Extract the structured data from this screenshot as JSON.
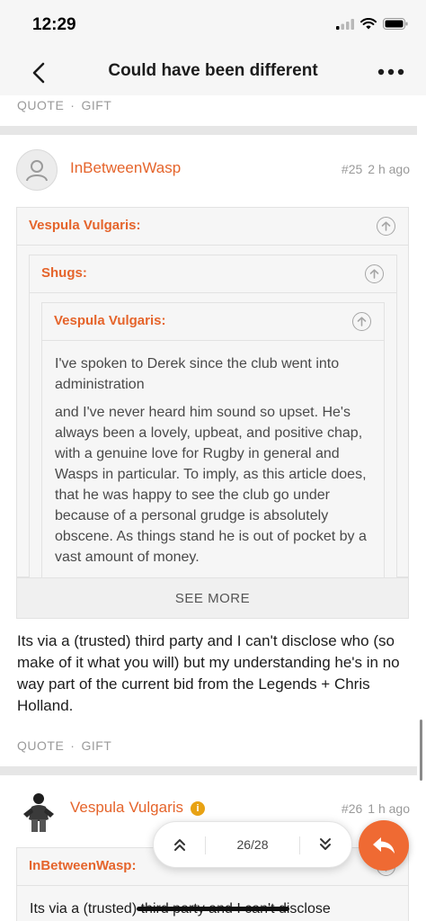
{
  "status": {
    "time": "12:29"
  },
  "nav": {
    "title": "Could have been different"
  },
  "actions": {
    "quote_label": "QUOTE",
    "separator": "·",
    "gift_label": "GIFT"
  },
  "post25": {
    "author": "InBetweenWasp",
    "number": "#25",
    "time_ago": "2 h ago",
    "quote_outer_author": "Vespula Vulgaris:",
    "quote_mid_author": "Shugs:",
    "quote_inner_author": "Vespula Vulgaris:",
    "quote_para1": "I've spoken to Derek since the club went into administration",
    "quote_para2": "and I've never heard him sound so upset. He's always been a lovely, upbeat, and positive chap, with a genuine love for Rugby in general and Wasps in particular. To imply, as this article does, that he was happy to see the club go under because of a personal grudge is absolutely obscene. As things stand he is out of pocket by a vast amount of money.",
    "see_more": "SEE MORE",
    "body": "Its via a (trusted) third party and I can't disclose who (so make of it what you will) but my understanding he's in no way part of the current bid from the Legends + Chris Holland."
  },
  "post26": {
    "author": "Vespula Vulgaris",
    "badge": "i",
    "number": "#26",
    "time_ago": "1 h ago",
    "quote_author": "InBetweenWasp:",
    "quote_text": "Its via a (trusted) third party and I can't disclose"
  },
  "pager": {
    "count": "26/28"
  },
  "icons": {
    "back": "chevron-left-icon",
    "more": "ellipsis-icon",
    "quote_up": "circle-arrow-up-icon",
    "pager_up": "double-chevron-up-icon",
    "pager_down": "double-chevron-down-icon",
    "reply": "reply-icon"
  },
  "colors": {
    "accent": "#e5642b",
    "fab": "#ef6a33",
    "badge": "#e8a213"
  }
}
